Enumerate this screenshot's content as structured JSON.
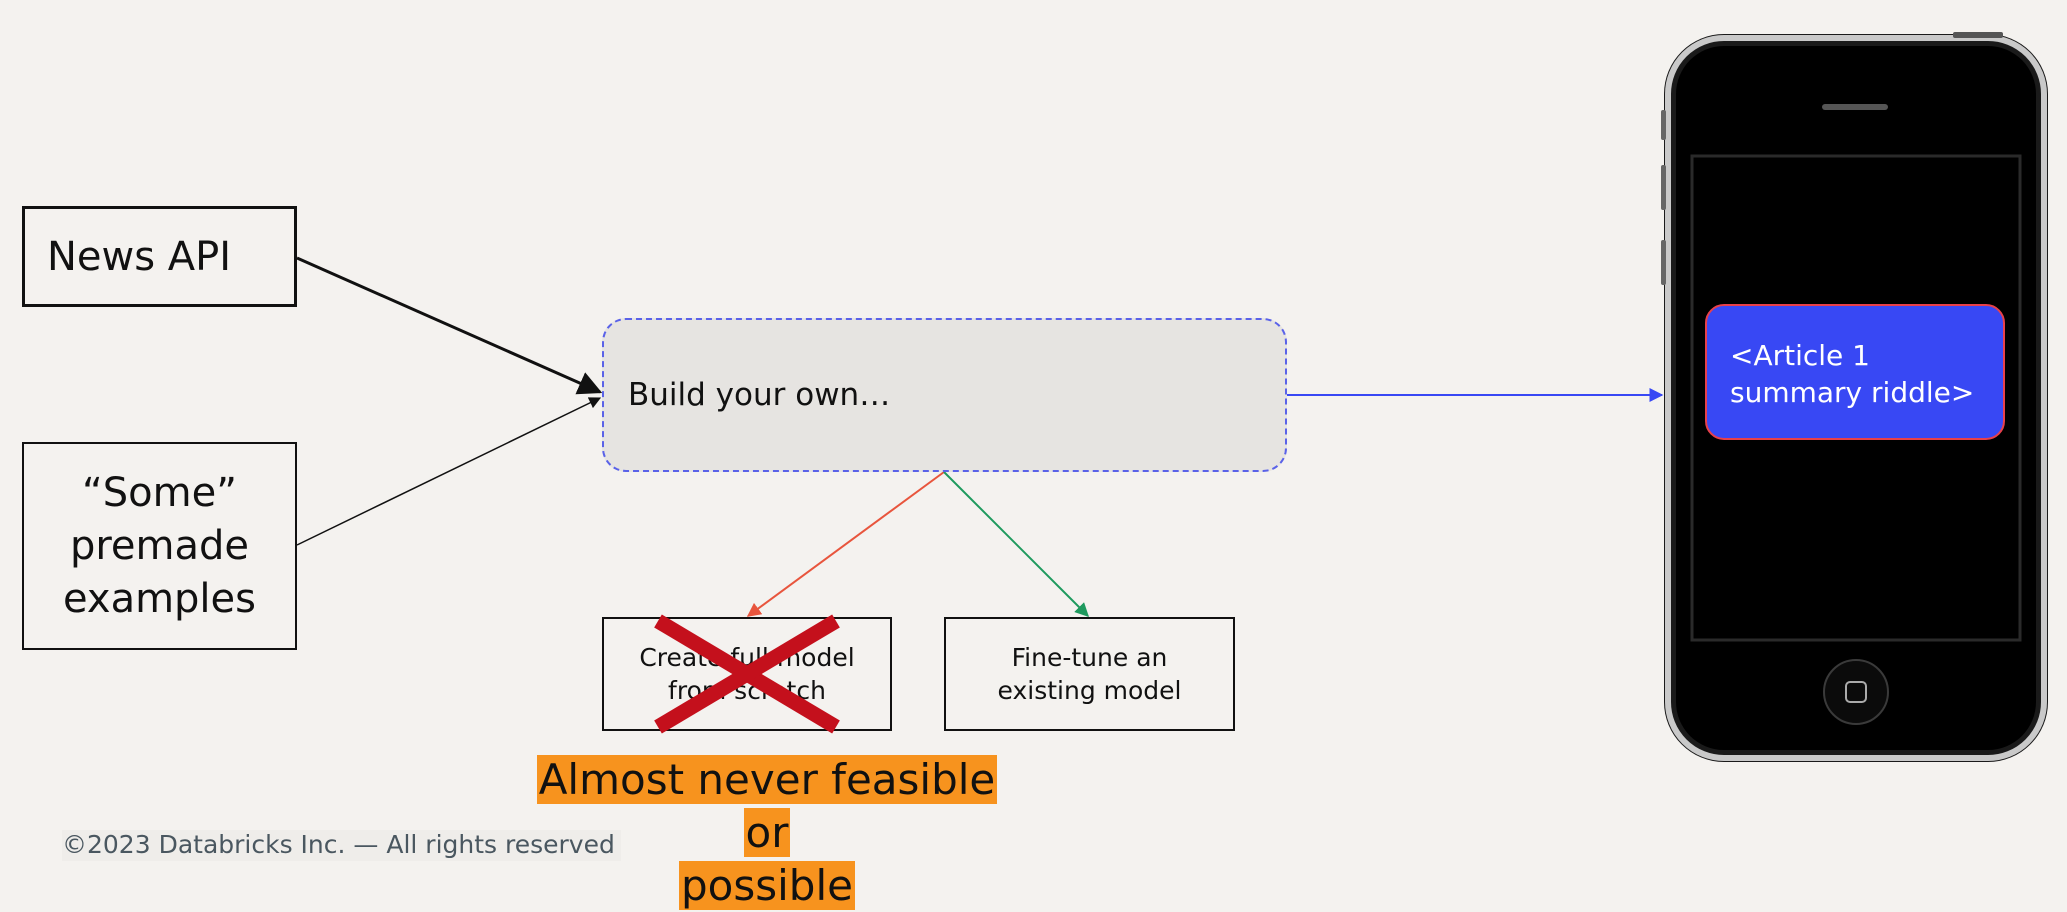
{
  "diagram": {
    "sources": {
      "news_api": "News API",
      "premade": [
        "“Some”",
        "premade",
        "examples"
      ]
    },
    "build_label": "Build your own…",
    "options": {
      "scratch": [
        "Create full model",
        "from scratch"
      ],
      "finetune": [
        "Fine-tune an",
        "existing model"
      ]
    },
    "warning": [
      "Almost never feasible or",
      "possible"
    ],
    "phone_card": [
      "<Article 1",
      "summary riddle>"
    ],
    "colors": {
      "accent_blue": "#3848f4",
      "red_arrow": "#e8553d",
      "green_arrow": "#1f9a5e",
      "cross": "#c4101c",
      "highlight": "#f7931e"
    }
  },
  "footer": "©2023 Databricks Inc. — All rights reserved"
}
